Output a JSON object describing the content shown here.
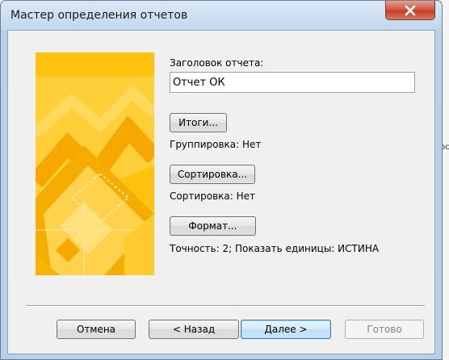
{
  "window": {
    "title": "Мастер определения отчетов"
  },
  "report_title": {
    "label": "Заголовок отчета:",
    "value": "Отчет ОК"
  },
  "totals": {
    "button_label": "Итоги...",
    "status": "Группировка: Нет"
  },
  "sorting": {
    "button_label": "Сортировка...",
    "status": "Сортировка: Нет"
  },
  "format": {
    "button_label": "Формат...",
    "status": "Точность: 2;  Показать единицы: ИСТИНА"
  },
  "footer": {
    "cancel_label": "Отмена",
    "back_label": "< Назад",
    "next_label": "Далее >",
    "finish_label": "Готово"
  },
  "background": {
    "visible_text": "ос"
  },
  "colors": {
    "accent_yellow": "#ffc20e",
    "close_red": "#c43d25",
    "primary_border": "#3c7fb1"
  }
}
